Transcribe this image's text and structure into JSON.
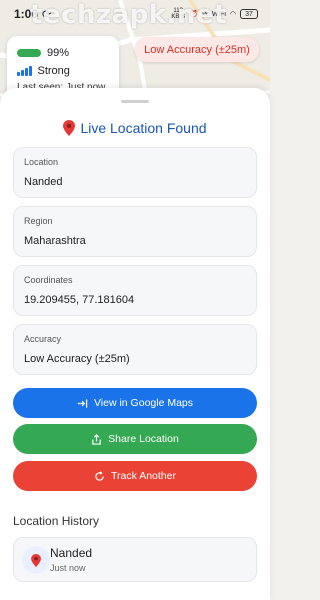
{
  "watermark": "techzapk.net",
  "status_bar": {
    "time": "1:06",
    "speed_value": "113",
    "speed_unit": "KB/S",
    "network_label": "Vo WiFi",
    "battery": "37"
  },
  "signal_card": {
    "battery_percent": "99%",
    "battery_level": 0.99,
    "signal_label": "Strong",
    "signal_strength": 4,
    "last_seen": "Last seen: Just now"
  },
  "accuracy_chip": "Low Accuracy (±25m)",
  "sheet": {
    "title": "Live Location Found",
    "fields": [
      {
        "label": "Location",
        "value": "Nanded"
      },
      {
        "label": "Region",
        "value": "Maharashtra"
      },
      {
        "label": "Coordinates",
        "value": "19.209455, 77.181604"
      },
      {
        "label": "Accuracy",
        "value": "Low Accuracy (±25m)"
      }
    ],
    "buttons": {
      "maps": "View in Google Maps",
      "share": "Share Location",
      "track": "Track Another"
    },
    "history": {
      "title": "Location History",
      "items": [
        {
          "name": "Nanded",
          "time": "Just now"
        }
      ]
    }
  },
  "colors": {
    "title_blue": "#1a56b8",
    "maps_button": "#1a73e8",
    "share_button": "#34a853",
    "track_button": "#ea4335",
    "accuracy_text": "#d93025",
    "accuracy_bg": "#fce8e6"
  },
  "icons": {
    "title": "map-pin-icon",
    "maps_button": "open-external-icon",
    "share_button": "share-icon",
    "track_button": "refresh-icon",
    "history_item": "map-pin-icon",
    "signal": "signal-bars-icon",
    "battery": "battery-icon"
  }
}
